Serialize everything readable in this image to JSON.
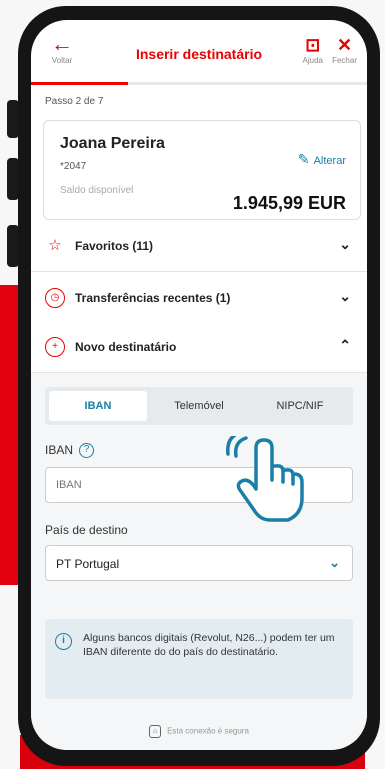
{
  "header": {
    "back_label": "Voltar",
    "title": "Inserir destinatário",
    "help_label": "Ajuda",
    "close_label": "Fechar"
  },
  "progress": {
    "current_step": 2,
    "total_steps": 7,
    "fraction": 0.29
  },
  "step_text": "Passo 2 de 7",
  "account": {
    "name": "Joana Pereira",
    "number": "*2047",
    "change_label": "Alterar",
    "balance_label": "Saldo disponível",
    "balance": "1.945,99 EUR"
  },
  "sections": {
    "favorites": "Favoritos (11)",
    "recent": "Transferências recentes (1)",
    "new_recipient": "Novo destinatário"
  },
  "tabs": [
    "IBAN",
    "Telemóvel",
    "NIPC/NIF"
  ],
  "iban": {
    "label": "IBAN",
    "placeholder": "IBAN",
    "help_glyph": "?"
  },
  "country": {
    "label": "País de destino",
    "value": "PT Portugal"
  },
  "info": {
    "glyph": "i",
    "text": "Alguns bancos digitais (Revolut, N26...) podem ter um IBAN diferente do do país do destinatário."
  },
  "secure_text": "Esta conexão é segura",
  "colors": {
    "brand": "#ec0000",
    "accent": "#1a7fa6",
    "panel": "#f4f6f7"
  },
  "icons": [
    "back-arrow-icon",
    "chat-help-icon",
    "close-icon",
    "pencil-icon",
    "star-icon",
    "clock-icon",
    "plus-circle-icon",
    "chevron-down-icon",
    "chevron-up-icon",
    "help-circle-icon",
    "info-icon",
    "lock-icon",
    "hand-pointer-icon"
  ]
}
